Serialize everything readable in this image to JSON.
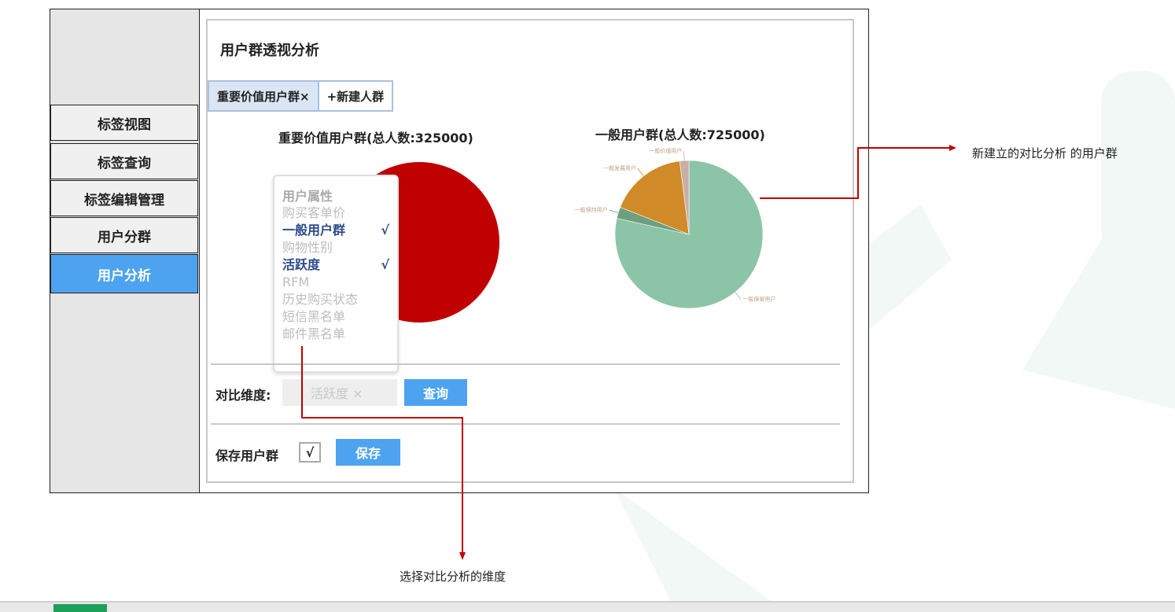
{
  "sidebar": {
    "items": [
      {
        "label": "标签视图",
        "active": false
      },
      {
        "label": "标签查询",
        "active": false
      },
      {
        "label": "标签编辑管理",
        "active": false
      },
      {
        "label": "用户分群",
        "active": false
      },
      {
        "label": "用户分析",
        "active": true
      }
    ]
  },
  "panel": {
    "title": "用户群透视分析",
    "tabs": {
      "selected": "重要价值用户群×",
      "new": "+新建人群"
    }
  },
  "charts": {
    "left": {
      "title": "重要价值用户群(总人数:325000)"
    },
    "right": {
      "title": "一般用户群(总人数:725000)"
    }
  },
  "chart_data": [
    {
      "type": "pie",
      "title": "重要价值用户群(总人数:325000)",
      "slices": [
        {
          "label": "",
          "value": 100,
          "color": "#c00000"
        }
      ]
    },
    {
      "type": "pie",
      "title": "一般用户群(总人数:725000)",
      "slices": [
        {
          "label": "一般保留用户",
          "value": 78.5,
          "color": "#8cc4a8"
        },
        {
          "label": "一般保持用户",
          "value": 2.5,
          "color": "#6f9f7f"
        },
        {
          "label": "一般发展用户",
          "value": 17,
          "color": "#d08a27"
        },
        {
          "label": "一般价值用户",
          "value": 2,
          "color": "#c9aea8"
        }
      ]
    }
  ],
  "dimension_menu": {
    "header": "用户属性",
    "items": [
      {
        "label": "购买客单价",
        "checked": false
      },
      {
        "label": "一般用户群",
        "checked": true
      },
      {
        "label": "购物性别",
        "checked": false
      },
      {
        "label": "活跃度",
        "checked": true
      },
      {
        "label": "RFM",
        "checked": false
      },
      {
        "label": "历史购买状态",
        "checked": false
      },
      {
        "label": "短信黑名单",
        "checked": false
      },
      {
        "label": "邮件黑名单",
        "checked": false
      }
    ],
    "check_mark": "√"
  },
  "compare": {
    "label": "对比维度:",
    "value": "活跃度 ×",
    "query_button": "查询"
  },
  "save": {
    "label": "保存用户群",
    "checkbox": "√",
    "save_button": "保存"
  },
  "annotations": {
    "right": "新建立的对比分析 的用户群",
    "bottom": "选择对比分析的维度"
  },
  "colors": {
    "accent": "#4da3f0",
    "red_pie": "#c00000",
    "green_pie": "#8cc4a8",
    "orange_pie": "#d08a27",
    "annotation_line": "#c00000",
    "footer_green": "#1ca05a"
  }
}
